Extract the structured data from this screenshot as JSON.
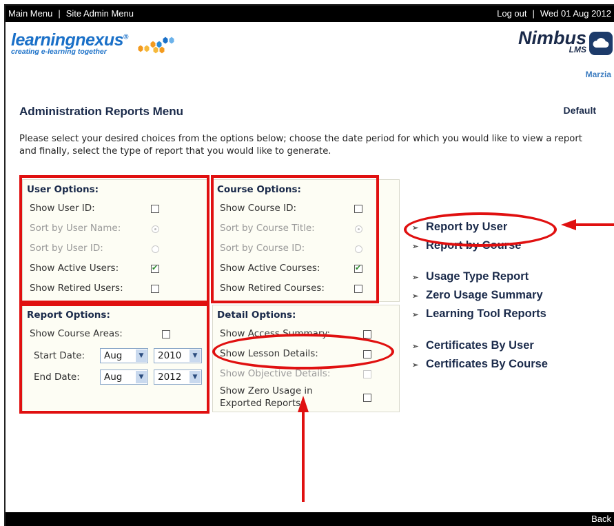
{
  "topbar": {
    "main_menu": "Main Menu",
    "separator": "|",
    "site_admin_menu": "Site Admin Menu",
    "logout": "Log out",
    "date": "Wed 01 Aug 2012"
  },
  "logo": {
    "brand": "learningnexus",
    "registered": "®",
    "tagline": "creating e-learning together"
  },
  "nimbus": {
    "name": "Nimbus",
    "lms": "LMS",
    "user": "Marzia"
  },
  "page": {
    "title": "Administration Reports Menu",
    "profile": "Default",
    "intro": "Please select your desired choices from the options below; choose the date period for which you would like to view a report and finally, select the type of report that you would like to generate."
  },
  "user_options": {
    "title": "User Options:",
    "show_user_id": "Show User ID:",
    "sort_by_user_name": "Sort by User Name:",
    "sort_by_user_id": "Sort by User ID:",
    "show_active_users": "Show Active Users:",
    "show_retired_users": "Show Retired Users:"
  },
  "course_options": {
    "title": "Course Options:",
    "show_course_id": "Show Course ID:",
    "sort_by_course_title": "Sort by Course Title:",
    "sort_by_course_id": "Sort by Course ID:",
    "show_active_courses": "Show Active Courses:",
    "show_retired_courses": "Show Retired Courses:"
  },
  "report_options": {
    "title": "Report Options:",
    "show_course_areas": "Show Course Areas:",
    "start_date": "Start Date:",
    "end_date": "End Date:",
    "start_month": "Aug",
    "start_year": "2010",
    "end_month": "Aug",
    "end_year": "2012"
  },
  "detail_options": {
    "title": "Detail Options:",
    "show_access_summary": "Show Access Summary:",
    "show_lesson_details": "Show Lesson Details:",
    "show_objective_details": "Show Objective Details:",
    "show_zero_usage_1": "Show Zero Usage in",
    "show_zero_usage_2": "Exported Reports:"
  },
  "reports": {
    "by_user": "Report by User",
    "by_course": "Report by Course",
    "usage_type": "Usage Type Report",
    "zero_usage": "Zero Usage Summary",
    "learning_tool": "Learning Tool Reports",
    "certs_by_user": "Certificates By User",
    "certs_by_course": "Certificates By Course",
    "chevron": "➢"
  },
  "bottombar": {
    "back": "Back"
  },
  "colors": {
    "annotation": "#e01010",
    "brand_blue": "#1a70c8",
    "heading": "#1a2a4a"
  }
}
